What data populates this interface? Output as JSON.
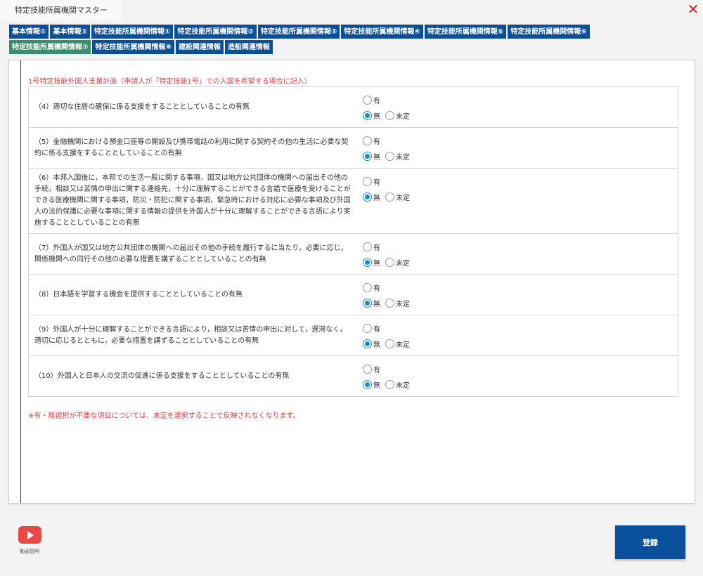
{
  "window": {
    "title": "特定技能所属機関マスター",
    "close_label": "✕"
  },
  "tabs": {
    "row1": [
      "基本情報①",
      "基本情報②",
      "特定技能所属機関情報①",
      "特定技能所属機関情報②",
      "特定技能所属機関情報③",
      "特定技能所属機関情報④",
      "特定技能所属機関情報⑤",
      "特定技能所属機関情報⑥"
    ],
    "row2": [
      "特定技能所属機関情報⑦",
      "特定技能所属機関情報⑧",
      "建設関連情報",
      "造船関連情報"
    ],
    "active": "特定技能所属機関情報⑦"
  },
  "form": {
    "heading": "1号特定技能外国人支援計画（申請人が「特定技能1号」での入国を希望する場合に記入）",
    "options": {
      "yes": "有",
      "no": "無",
      "undecided": "未定"
    },
    "questions": [
      {
        "text": "（4）適切な住居の確保に係る支援をすることとしていることの有無",
        "selected": "無"
      },
      {
        "text": "（5）金融機関における預金口座等の開設及び携帯電話の利用に関する契約その他の生活に必要な契約に係る支援をすることとしていることの有無",
        "selected": "無"
      },
      {
        "text": "（6）本邦入国後に，本邦での生活一般に関する事項，国又は地方公共団体の機関への届出その他の手続，相談又は苦情の申出に関する連絡先，十分に理解することができる言語で医療を受けることができる医療機関に関する事項，防災・防犯に関する事項，緊急時における対応に必要な事項及び外国人の法的保護に必要な事項に関する情報の提供を外国人が十分に理解することができる言語により実施することとしていることの有無",
        "selected": "無"
      },
      {
        "text": "（7）外国人が国又は地方公共団体の機関への届出その他の手続を履行するに当たり，必要に応じ，関係機関への同行その他の必要な措置を講ずることとしていることの有無",
        "selected": "無"
      },
      {
        "text": "（8）日本語を学習する機会を提供することとしていることの有無",
        "selected": "無"
      },
      {
        "text": "（9）外国人が十分に理解することができる言語により，相談又は苦情の申出に対して，遅滞なく，適切に応じるとともに，必要な措置を講ずることとしていることの有無",
        "selected": "無"
      },
      {
        "text": "（10）外国人と日本人の交流の促進に係る支援をすることとしていることの有無",
        "selected": "無"
      }
    ],
    "note": "※有・無選択が不要な項目については、未定を選択することで反映されなくなります。"
  },
  "footer": {
    "help_label": "動画説明",
    "help_icon": "youtube-play-icon",
    "submit_label": "登録"
  },
  "colors": {
    "tab": "#0a4f9c",
    "tab_active": "#3a8e6c",
    "accent_text": "#d64545",
    "radio": "#1a8cc4"
  }
}
